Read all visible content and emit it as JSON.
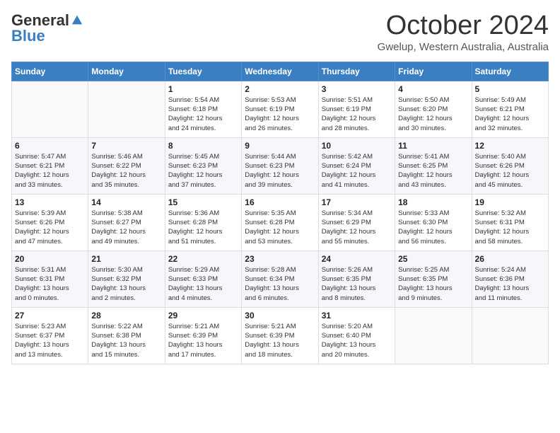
{
  "header": {
    "logo_general": "General",
    "logo_blue": "Blue",
    "month_title": "October 2024",
    "subtitle": "Gwelup, Western Australia, Australia"
  },
  "weekdays": [
    "Sunday",
    "Monday",
    "Tuesday",
    "Wednesday",
    "Thursday",
    "Friday",
    "Saturday"
  ],
  "weeks": [
    [
      {
        "day": "",
        "info": ""
      },
      {
        "day": "",
        "info": ""
      },
      {
        "day": "1",
        "info": "Sunrise: 5:54 AM\nSunset: 6:18 PM\nDaylight: 12 hours\nand 24 minutes."
      },
      {
        "day": "2",
        "info": "Sunrise: 5:53 AM\nSunset: 6:19 PM\nDaylight: 12 hours\nand 26 minutes."
      },
      {
        "day": "3",
        "info": "Sunrise: 5:51 AM\nSunset: 6:19 PM\nDaylight: 12 hours\nand 28 minutes."
      },
      {
        "day": "4",
        "info": "Sunrise: 5:50 AM\nSunset: 6:20 PM\nDaylight: 12 hours\nand 30 minutes."
      },
      {
        "day": "5",
        "info": "Sunrise: 5:49 AM\nSunset: 6:21 PM\nDaylight: 12 hours\nand 32 minutes."
      }
    ],
    [
      {
        "day": "6",
        "info": "Sunrise: 5:47 AM\nSunset: 6:21 PM\nDaylight: 12 hours\nand 33 minutes."
      },
      {
        "day": "7",
        "info": "Sunrise: 5:46 AM\nSunset: 6:22 PM\nDaylight: 12 hours\nand 35 minutes."
      },
      {
        "day": "8",
        "info": "Sunrise: 5:45 AM\nSunset: 6:23 PM\nDaylight: 12 hours\nand 37 minutes."
      },
      {
        "day": "9",
        "info": "Sunrise: 5:44 AM\nSunset: 6:23 PM\nDaylight: 12 hours\nand 39 minutes."
      },
      {
        "day": "10",
        "info": "Sunrise: 5:42 AM\nSunset: 6:24 PM\nDaylight: 12 hours\nand 41 minutes."
      },
      {
        "day": "11",
        "info": "Sunrise: 5:41 AM\nSunset: 6:25 PM\nDaylight: 12 hours\nand 43 minutes."
      },
      {
        "day": "12",
        "info": "Sunrise: 5:40 AM\nSunset: 6:26 PM\nDaylight: 12 hours\nand 45 minutes."
      }
    ],
    [
      {
        "day": "13",
        "info": "Sunrise: 5:39 AM\nSunset: 6:26 PM\nDaylight: 12 hours\nand 47 minutes."
      },
      {
        "day": "14",
        "info": "Sunrise: 5:38 AM\nSunset: 6:27 PM\nDaylight: 12 hours\nand 49 minutes."
      },
      {
        "day": "15",
        "info": "Sunrise: 5:36 AM\nSunset: 6:28 PM\nDaylight: 12 hours\nand 51 minutes."
      },
      {
        "day": "16",
        "info": "Sunrise: 5:35 AM\nSunset: 6:28 PM\nDaylight: 12 hours\nand 53 minutes."
      },
      {
        "day": "17",
        "info": "Sunrise: 5:34 AM\nSunset: 6:29 PM\nDaylight: 12 hours\nand 55 minutes."
      },
      {
        "day": "18",
        "info": "Sunrise: 5:33 AM\nSunset: 6:30 PM\nDaylight: 12 hours\nand 56 minutes."
      },
      {
        "day": "19",
        "info": "Sunrise: 5:32 AM\nSunset: 6:31 PM\nDaylight: 12 hours\nand 58 minutes."
      }
    ],
    [
      {
        "day": "20",
        "info": "Sunrise: 5:31 AM\nSunset: 6:31 PM\nDaylight: 13 hours\nand 0 minutes."
      },
      {
        "day": "21",
        "info": "Sunrise: 5:30 AM\nSunset: 6:32 PM\nDaylight: 13 hours\nand 2 minutes."
      },
      {
        "day": "22",
        "info": "Sunrise: 5:29 AM\nSunset: 6:33 PM\nDaylight: 13 hours\nand 4 minutes."
      },
      {
        "day": "23",
        "info": "Sunrise: 5:28 AM\nSunset: 6:34 PM\nDaylight: 13 hours\nand 6 minutes."
      },
      {
        "day": "24",
        "info": "Sunrise: 5:26 AM\nSunset: 6:35 PM\nDaylight: 13 hours\nand 8 minutes."
      },
      {
        "day": "25",
        "info": "Sunrise: 5:25 AM\nSunset: 6:35 PM\nDaylight: 13 hours\nand 9 minutes."
      },
      {
        "day": "26",
        "info": "Sunrise: 5:24 AM\nSunset: 6:36 PM\nDaylight: 13 hours\nand 11 minutes."
      }
    ],
    [
      {
        "day": "27",
        "info": "Sunrise: 5:23 AM\nSunset: 6:37 PM\nDaylight: 13 hours\nand 13 minutes."
      },
      {
        "day": "28",
        "info": "Sunrise: 5:22 AM\nSunset: 6:38 PM\nDaylight: 13 hours\nand 15 minutes."
      },
      {
        "day": "29",
        "info": "Sunrise: 5:21 AM\nSunset: 6:39 PM\nDaylight: 13 hours\nand 17 minutes."
      },
      {
        "day": "30",
        "info": "Sunrise: 5:21 AM\nSunset: 6:39 PM\nDaylight: 13 hours\nand 18 minutes."
      },
      {
        "day": "31",
        "info": "Sunrise: 5:20 AM\nSunset: 6:40 PM\nDaylight: 13 hours\nand 20 minutes."
      },
      {
        "day": "",
        "info": ""
      },
      {
        "day": "",
        "info": ""
      }
    ]
  ]
}
